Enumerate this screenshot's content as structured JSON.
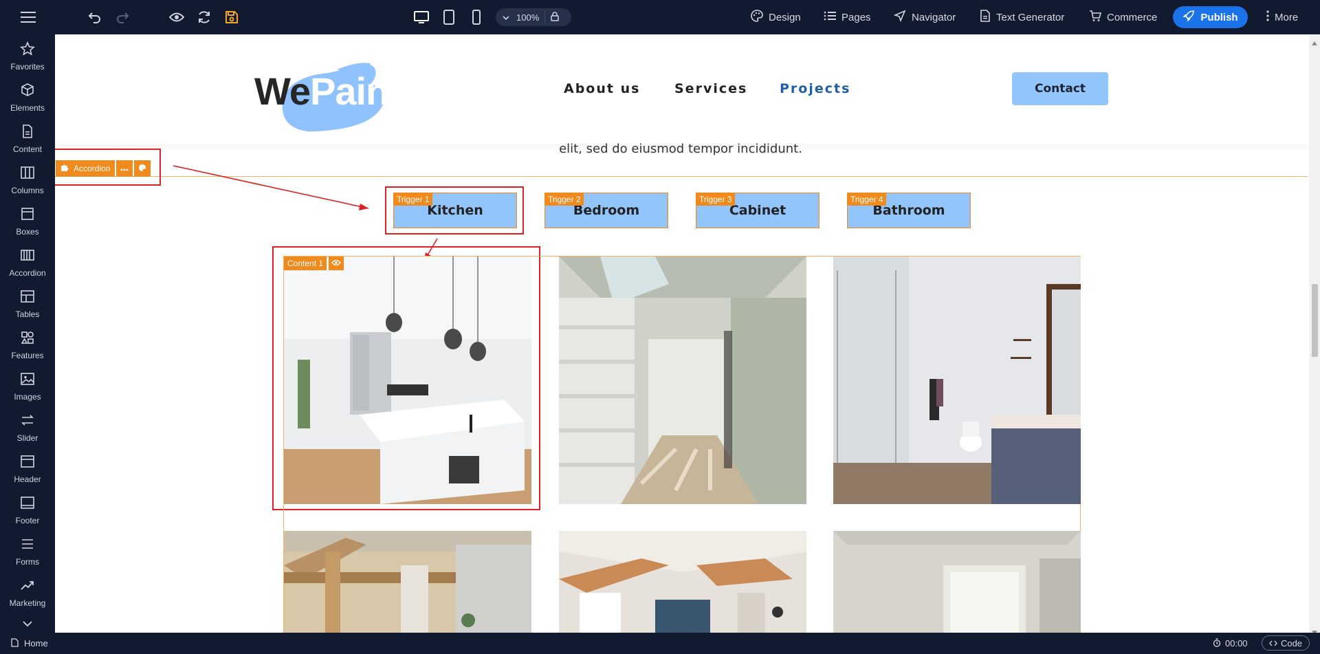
{
  "toolbar": {
    "zoom": "100%",
    "design": "Design",
    "pages": "Pages",
    "navigator": "Navigator",
    "text_generator": "Text Generator",
    "commerce": "Commerce",
    "publish": "Publish",
    "more": "More"
  },
  "sidebar": {
    "items": [
      {
        "label": "Favorites",
        "icon": "star-icon"
      },
      {
        "label": "Elements",
        "icon": "cube-icon"
      },
      {
        "label": "Content",
        "icon": "document-icon"
      },
      {
        "label": "Columns",
        "icon": "columns-icon"
      },
      {
        "label": "Boxes",
        "icon": "box-icon"
      },
      {
        "label": "Accordion",
        "icon": "accordion-icon"
      },
      {
        "label": "Tables",
        "icon": "table-icon"
      },
      {
        "label": "Features",
        "icon": "features-icon"
      },
      {
        "label": "Images",
        "icon": "image-icon"
      },
      {
        "label": "Slider",
        "icon": "slider-icon"
      },
      {
        "label": "Header",
        "icon": "header-icon"
      },
      {
        "label": "Footer",
        "icon": "footer-icon"
      },
      {
        "label": "Forms",
        "icon": "forms-icon"
      },
      {
        "label": "Marketing",
        "icon": "marketing-icon"
      }
    ]
  },
  "site": {
    "logo": {
      "part1": "We",
      "part2": "Paint"
    },
    "nav": [
      {
        "label": "About us",
        "active": false
      },
      {
        "label": "Services",
        "active": false
      },
      {
        "label": "Projects",
        "active": true
      }
    ],
    "contact": "Contact",
    "intro": "elit, sed do eiusmod tempor incididunt.",
    "colors": {
      "accent": "#93c5fd",
      "active_nav": "#1d5fa8",
      "editor_orange": "#f08a1c",
      "highlight_red": "#e02020"
    }
  },
  "accordion": {
    "label": "Accordion",
    "triggers": [
      {
        "tag": "Trigger 1",
        "label": "Kitchen"
      },
      {
        "tag": "Trigger 2",
        "label": "Bedroom"
      },
      {
        "tag": "Trigger 3",
        "label": "Cabinet"
      },
      {
        "tag": "Trigger 4",
        "label": "Bathroom"
      }
    ],
    "content_tag": "Content 1"
  },
  "status": {
    "page": "Home",
    "timer": "00:00",
    "code": "Code"
  }
}
